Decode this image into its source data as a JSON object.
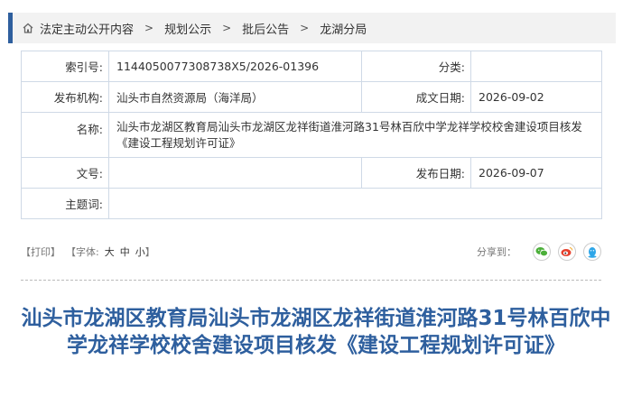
{
  "breadcrumb": {
    "items": [
      "法定主动公开内容",
      "规划公示",
      "批后公告",
      "龙湖分局"
    ],
    "separator": ">"
  },
  "info": {
    "index_label": "索引号:",
    "index_value": "1144050077308738X5/2026-01396",
    "category_label": "分类:",
    "category_value": "",
    "publisher_label": "发布机构:",
    "publisher_value": "汕头市自然资源局（海洋局）",
    "created_label": "成文日期:",
    "created_value": "2026-09-02",
    "name_label": "名称:",
    "name_value": "汕头市龙湖区教育局汕头市龙湖区龙祥街道淮河路31号林百欣中学龙祥学校校舍建设项目核发《建设工程规划许可证》",
    "doc_no_label": "文号:",
    "doc_no_value": "",
    "published_label": "发布日期:",
    "published_value": "2026-09-07",
    "subject_label": "主题词:",
    "subject_value": ""
  },
  "tools": {
    "print_label": "【打印】",
    "font_size_label": "【字体:",
    "font_large": "大",
    "font_medium": "中",
    "font_small": "小",
    "bracket_close": "】",
    "share_label": "分享到："
  },
  "share_icons": [
    "wechat-icon",
    "weibo-icon",
    "qq-icon"
  ],
  "colors": {
    "accent": "#2e5f9e",
    "wechat": "#4caf3a",
    "weibo": "#e6402d",
    "qq": "#2ea6e8"
  },
  "article": {
    "title": "汕头市龙湖区教育局汕头市龙湖区龙祥街道淮河路31号林百欣中学龙祥学校校舍建设项目核发《建设工程规划许可证》"
  }
}
